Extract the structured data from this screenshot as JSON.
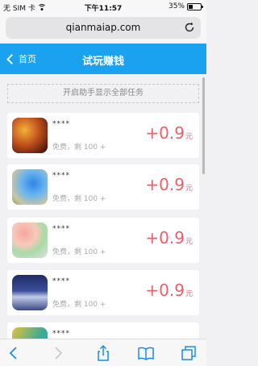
{
  "status_bar": {
    "carrier": "无 SIM 卡",
    "time": "下午11:57",
    "battery": "35%",
    "battery_level": 0.35
  },
  "browser": {
    "url": "qianmaiap.com",
    "reload_icon": "reload-icon",
    "toolbar": [
      "back-icon",
      "forward-icon",
      "share-icon",
      "bookmarks-icon",
      "tabs-icon"
    ]
  },
  "header": {
    "back_label": "首页",
    "title": "试玩赚钱"
  },
  "notice": "开启助手显示全部任务",
  "tasks": [
    {
      "name": "****",
      "subtitle": "免费，剩 100 +",
      "reward": "+0.9",
      "unit": "元"
    },
    {
      "name": "****",
      "subtitle": "免费，剩 100 +",
      "reward": "+0.9",
      "unit": "元"
    },
    {
      "name": "****",
      "subtitle": "免费，剩 100 +",
      "reward": "+0.9",
      "unit": "元"
    },
    {
      "name": "****",
      "subtitle": "免费，剩 100 +",
      "reward": "+0.9",
      "unit": "元"
    },
    {
      "name": "****",
      "subtitle": "",
      "reward": "",
      "unit": ""
    }
  ],
  "colors": {
    "accent": "#1aa1ef",
    "reward": "#ef5e68",
    "background": "#f1f1f3"
  }
}
